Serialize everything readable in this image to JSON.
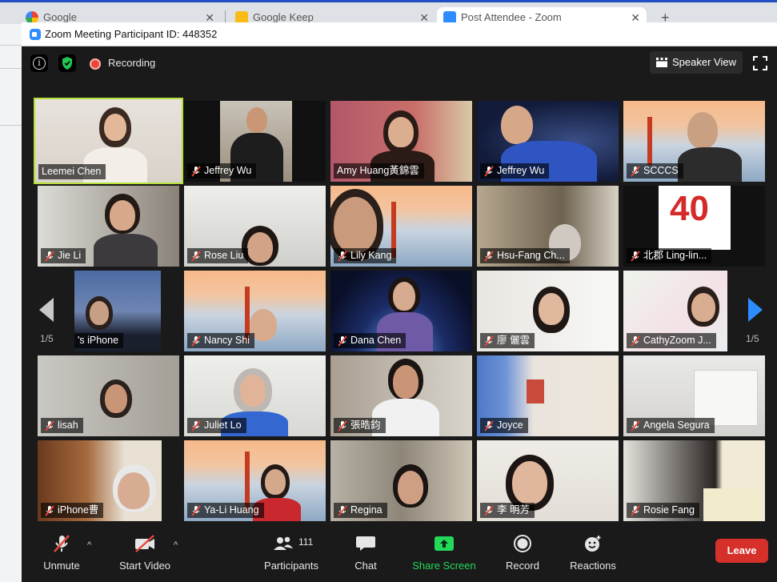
{
  "browser": {
    "tabs": [
      {
        "title": "Google"
      },
      {
        "title": "Google Keep"
      },
      {
        "title": "Post Attendee - Zoom"
      }
    ],
    "new_tab": "+"
  },
  "window": {
    "title": "Zoom Meeting Participant ID: 448352"
  },
  "topbar": {
    "recording_label": "Recording",
    "view_label": "Speaker View"
  },
  "gallery": {
    "page_left": "1/5",
    "page_right": "1/5",
    "participants": [
      {
        "name": "Leemei Chen",
        "muted": false,
        "active": true
      },
      {
        "name": "Jeffrey Wu",
        "muted": true
      },
      {
        "name": "Amy Huang黃錦雲",
        "muted": false
      },
      {
        "name": "Jeffrey Wu",
        "muted": true
      },
      {
        "name": "SCCCS",
        "muted": true
      },
      {
        "name": "Jie Li",
        "muted": true
      },
      {
        "name": "Rose Liu",
        "muted": true
      },
      {
        "name": "Lily Kang",
        "muted": true
      },
      {
        "name": "Hsu-Fang Ch...",
        "muted": true
      },
      {
        "name": "北郡 Ling-lin...",
        "muted": true
      },
      {
        "name": "'s iPhone",
        "muted": false
      },
      {
        "name": "Nancy Shi",
        "muted": true
      },
      {
        "name": "Dana Chen",
        "muted": true
      },
      {
        "name": "廖 儷雲",
        "muted": true
      },
      {
        "name": "CathyZoom J...",
        "muted": true
      },
      {
        "name": "lisah",
        "muted": true
      },
      {
        "name": "Juliet Lo",
        "muted": true
      },
      {
        "name": "張晧鈞",
        "muted": true
      },
      {
        "name": "Joyce",
        "muted": true
      },
      {
        "name": "Angela Segura",
        "muted": true
      },
      {
        "name": "iPhone曹",
        "muted": true
      },
      {
        "name": "Ya-Li Huang",
        "muted": true
      },
      {
        "name": "Regina",
        "muted": true
      },
      {
        "name": "李 明芳",
        "muted": true
      },
      {
        "name": "Rosie Fang",
        "muted": true
      }
    ]
  },
  "toolbar": {
    "unmute": "Unmute",
    "start_video": "Start Video",
    "participants": "Participants",
    "participant_count": "111",
    "chat": "Chat",
    "share_screen": "Share Screen",
    "record": "Record",
    "reactions": "Reactions",
    "leave": "Leave"
  },
  "colors": {
    "accent_blue": "#2d8cff",
    "share_green": "#23d959",
    "leave_red": "#d6302a",
    "active_speaker": "#b5e03a",
    "muted_red": "#e8473a"
  }
}
